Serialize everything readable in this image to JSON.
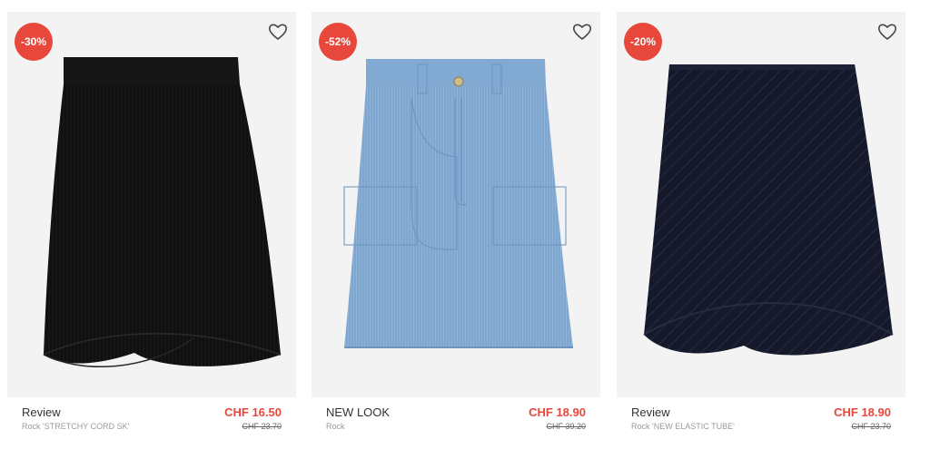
{
  "products": [
    {
      "badge": "-30%",
      "brand": "Review",
      "name": "Rock 'STRETCHY CORD SK'",
      "price": "CHF 16.50",
      "old_price": "CHF 23.70",
      "color": "#111111",
      "icon": "heart-outline-icon"
    },
    {
      "badge": "-52%",
      "brand": "NEW LOOK",
      "name": "Rock",
      "price": "CHF 18.90",
      "old_price": "CHF 39.20",
      "color": "#7ea6cf",
      "icon": "heart-outline-icon"
    },
    {
      "badge": "-20%",
      "brand": "Review",
      "name": "Rock 'NEW ELASTIC TUBE'",
      "price": "CHF 18.90",
      "old_price": "CHF 23.70",
      "color": "#15192a",
      "icon": "heart-outline-icon"
    }
  ],
  "colors": {
    "sale": "#e8483b",
    "tile_bg": "#f3f3f3"
  }
}
